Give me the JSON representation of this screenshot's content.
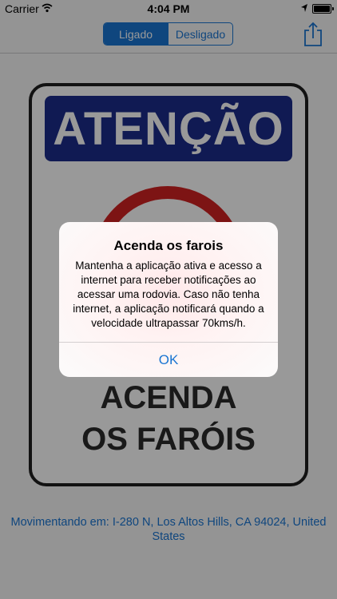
{
  "status_bar": {
    "carrier": "Carrier",
    "time": "4:04 PM"
  },
  "nav": {
    "segments": [
      {
        "label": "Ligado",
        "selected": true
      },
      {
        "label": "Desligado",
        "selected": false
      }
    ],
    "share_icon": "share-icon"
  },
  "sign": {
    "banner": "ATENÇÃO",
    "line1": "ACENDA",
    "line2": "OS FARÓIS",
    "colors": {
      "banner": "#1c2c8a",
      "ring": "#d12222"
    }
  },
  "location_text": "Movimentando em: I-280 N, Los Altos Hills, CA  94024, United States",
  "alert": {
    "title": "Acenda os farois",
    "message": "Mantenha a aplicação ativa e acesso a internet para receber notificações ao acessar uma rodovia. Caso não tenha internet, a aplicação notificará quando a velocidade ultrapassar 70kms/h.",
    "button": "OK"
  },
  "colors": {
    "accent": "#1a75d2"
  }
}
